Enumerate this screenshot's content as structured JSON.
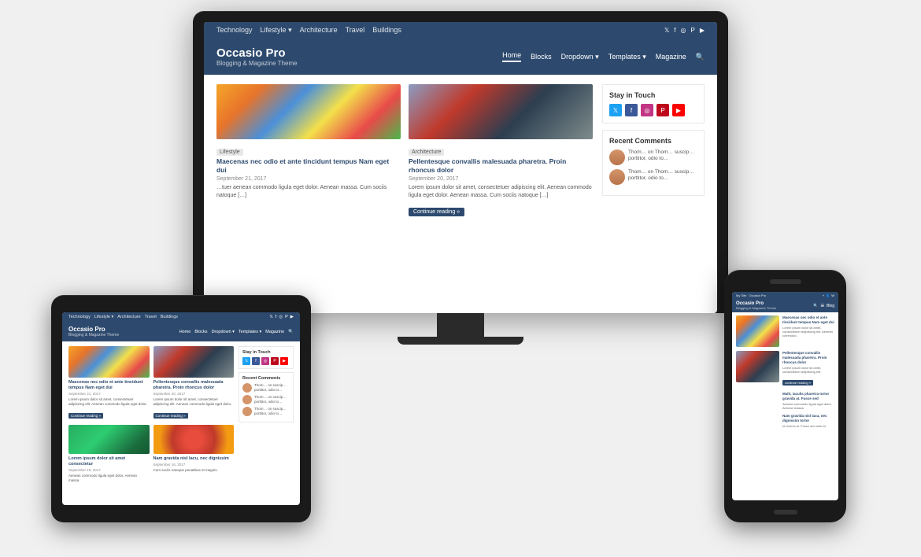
{
  "scene": {
    "background": "#f0f0f0"
  },
  "website": {
    "topbar": {
      "nav": [
        "Technology",
        "Lifestyle ▾",
        "Architecture",
        "Travel",
        "Buildings"
      ],
      "icons": [
        "𝕏",
        "f",
        "◎",
        "𝗣",
        "▶"
      ]
    },
    "header": {
      "logo_title": "Occasio Pro",
      "logo_subtitle": "Blogging & Magazine Theme",
      "nav": [
        "Home",
        "Blocks",
        "Dropdown ▾",
        "Templates ▾",
        "Magazine",
        "🔍"
      ]
    },
    "articles": [
      {
        "category": "Lifestyle",
        "title": "Maecenas nec odio et ante tincidunt tempus Nam eget dui",
        "date": "September 21, 2017",
        "excerpt": "…tuer aenean commodo ligula eget dolor. Aenean massa. Cum sociis natoque […]",
        "img_type": "umbrella",
        "has_read_more": false
      },
      {
        "category": "Architecture",
        "title": "Pellentesque convallis malesuada pharetra. Proin rhoncus dolor",
        "date": "September 20, 2017",
        "excerpt": "Lorem ipsum dolor sit amet, consectetuer adipiscing elit. Aenean commodo ligula eget dolor. Aenean massa. Cum sociis natoque […]",
        "img_type": "building",
        "has_read_more": true
      }
    ],
    "sidebar": {
      "stay_in_touch": {
        "title": "Stay in Touch",
        "icons": [
          "twitter",
          "facebook",
          "instagram",
          "pinterest",
          "youtube"
        ]
      },
      "recent_comments": {
        "title": "Recent Comments",
        "comments": [
          {
            "text": "Thom… on Thom… suscip… porttitor, odio to…"
          },
          {
            "text": "Thom… on Thom… suscip… porttitor, odio to…"
          }
        ]
      }
    }
  }
}
